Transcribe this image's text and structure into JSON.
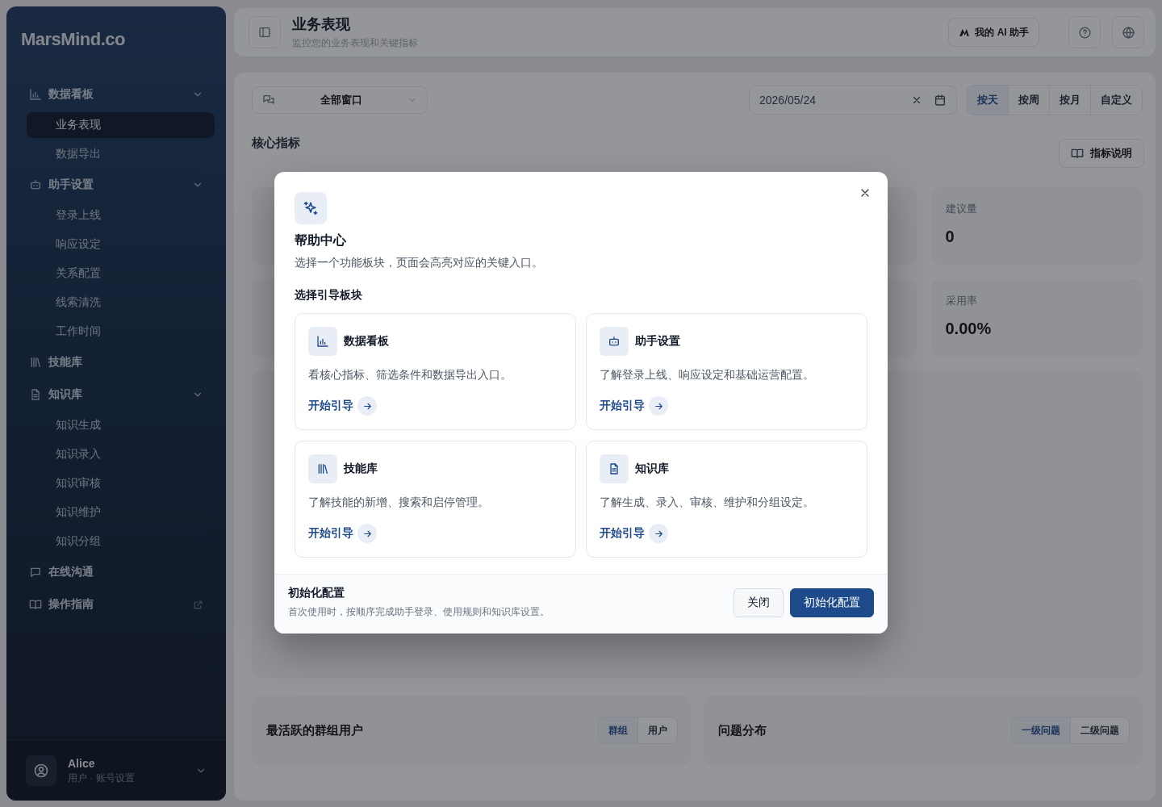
{
  "sidebar": {
    "logo": "MarsMind.co",
    "items": [
      {
        "label": "数据看板",
        "selected": false,
        "expanded": true,
        "children": [
          {
            "label": "业务表现",
            "selected": true
          },
          {
            "label": "数据导出",
            "selected": false
          }
        ]
      },
      {
        "label": "助手设置",
        "selected": false,
        "expanded": true,
        "children": [
          {
            "label": "登录上线",
            "selected": false
          },
          {
            "label": "响应设定",
            "selected": false
          },
          {
            "label": "关系配置",
            "selected": false
          },
          {
            "label": "线索清洗",
            "selected": false
          },
          {
            "label": "工作时间",
            "selected": false
          }
        ]
      },
      {
        "label": "技能库",
        "selected": false
      },
      {
        "label": "知识库",
        "selected": false,
        "expanded": true,
        "children": [
          {
            "label": "知识生成",
            "selected": false
          },
          {
            "label": "知识录入",
            "selected": false
          },
          {
            "label": "知识审核",
            "selected": false
          },
          {
            "label": "知识维护",
            "selected": false
          },
          {
            "label": "知识分组",
            "selected": false
          }
        ]
      },
      {
        "label": "在线沟通",
        "selected": false
      },
      {
        "label": "操作指南",
        "selected": false,
        "external": true
      }
    ],
    "user": {
      "name": "Alice",
      "subtitle": "用户 · 账号设置"
    }
  },
  "header": {
    "title": "业务表现",
    "subtitle": "监控您的业务表现和关键指标",
    "assistant_button": "我的 AI 助手"
  },
  "filters": {
    "channel_select": "全部窗口",
    "date_field": "2026/05/24",
    "periods": [
      {
        "label": "按天",
        "selected": true
      },
      {
        "label": "按周",
        "selected": false
      },
      {
        "label": "按月",
        "selected": false
      },
      {
        "label": "自定义",
        "selected": false
      }
    ]
  },
  "core_metrics": {
    "title": "核心指标",
    "guide_button": "指标说明",
    "metrics": [
      {
        "label": "建议量",
        "value": "0"
      },
      {
        "label": "采用率",
        "value": "0.00%"
      }
    ]
  },
  "panels": [
    {
      "title": "最活跃的群组用户",
      "toggles": [
        {
          "label": "群组",
          "selected": true
        },
        {
          "label": "用户",
          "selected": false
        }
      ]
    },
    {
      "title": "问题分布",
      "toggles": [
        {
          "label": "一级问题",
          "selected": true
        },
        {
          "label": "二级问题",
          "selected": false
        }
      ]
    }
  ],
  "help_dialog": {
    "title": "帮助中心",
    "description": "选择一个功能板块，页面会高亮对应的关键入口。",
    "section_title": "选择引导板块",
    "modules": [
      {
        "title": "数据看板",
        "description": "看核心指标、筛选条件和数据导出入口。",
        "action": "开始引导"
      },
      {
        "title": "助手设置",
        "description": "了解登录上线、响应设定和基础运营配置。",
        "action": "开始引导"
      },
      {
        "title": "技能库",
        "description": "了解技能的新增、搜索和启停管理。",
        "action": "开始引导"
      },
      {
        "title": "知识库",
        "description": "了解生成、录入、审核、维护和分组设定。",
        "action": "开始引导"
      }
    ],
    "footer": {
      "title": "初始化配置",
      "description": "首次使用时，按顺序完成助手登录、使用规则和知识库设置。",
      "buttons": [
        {
          "label": "关闭",
          "kind": "secondary"
        },
        {
          "label": "初始化配置",
          "kind": "primary"
        }
      ]
    }
  }
}
